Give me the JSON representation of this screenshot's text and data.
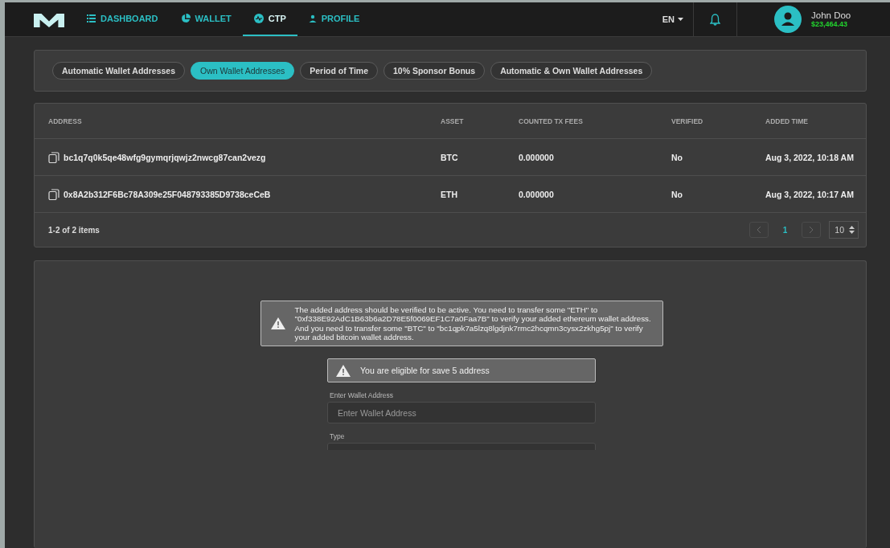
{
  "nav": {
    "items": [
      {
        "label": "DASHBOARD",
        "selected": false
      },
      {
        "label": "WALLET",
        "selected": false
      },
      {
        "label": "CTP",
        "selected": true
      },
      {
        "label": "PROFILE",
        "selected": false
      }
    ],
    "language": "EN",
    "user": {
      "name": "John Doo",
      "balance": "$23,464.43"
    }
  },
  "filters": [
    {
      "label": "Automatic Wallet Addresses",
      "selected": false
    },
    {
      "label": "Own Wallet Addresses",
      "selected": true
    },
    {
      "label": "Period of Time",
      "selected": false
    },
    {
      "label": "10% Sponsor Bonus",
      "selected": false
    },
    {
      "label": "Automatic & Own Wallet Addresses",
      "selected": false
    }
  ],
  "table": {
    "columns": [
      "ADDRESS",
      "ASSET",
      "COUNTED TX FEES",
      "VERIFIED",
      "ADDED TIME"
    ],
    "rows": [
      [
        "bc1q7q0k5qe48wfg9gymqrjqwjz2nwcg87can2vezg",
        "BTC",
        "0.000000",
        "No",
        "Aug 3, 2022, 10:18 AM"
      ],
      [
        "0x8A2b312F6Bc78A309e25F048793385D9738ceCeB",
        "ETH",
        "0.000000",
        "No",
        "Aug 3, 2022, 10:17 AM"
      ]
    ],
    "summary": "1-2 of 2 items",
    "page": "1",
    "page_size": "10"
  },
  "form": {
    "notice": "The added address should be verified to be active. You need to transfer some \"ETH\" to \"0xf338E92AdC1B63b6a2D78E5f0069EF1C7a0Faa7B\" to verify your added ethereum wallet address. And you need to transfer some \"BTC\" to \"bc1qpk7a5lzq8lgdjnk7rmc2hcqmn3cysx2zkhg5pj\" to verify your added bitcoin wallet address.",
    "eligibility": "You are eligible for save 5 address",
    "address_label": "Enter Wallet Address",
    "address_placeholder": "Enter Wallet Address",
    "type_label": "Type"
  }
}
